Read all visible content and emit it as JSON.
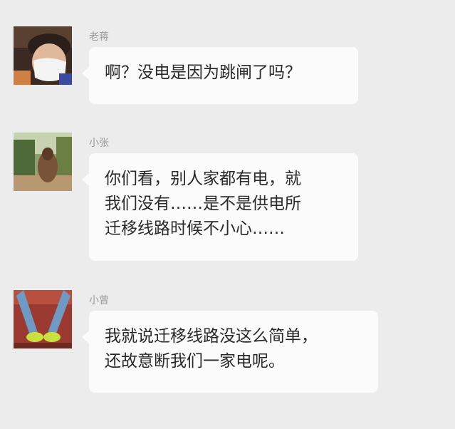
{
  "messages": [
    {
      "sender": "老蒋",
      "lines": [
        "啊？没电是因为跳闸了吗？"
      ]
    },
    {
      "sender": "小张",
      "lines": [
        "你们看，别人家都有电，就",
        "我们没有……是不是供电所",
        "迁移线路时候不小心……"
      ]
    },
    {
      "sender": "小曾",
      "lines": [
        "我就说迁移线路没这么简单，",
        "还故意断我们一家电呢。"
      ]
    }
  ]
}
